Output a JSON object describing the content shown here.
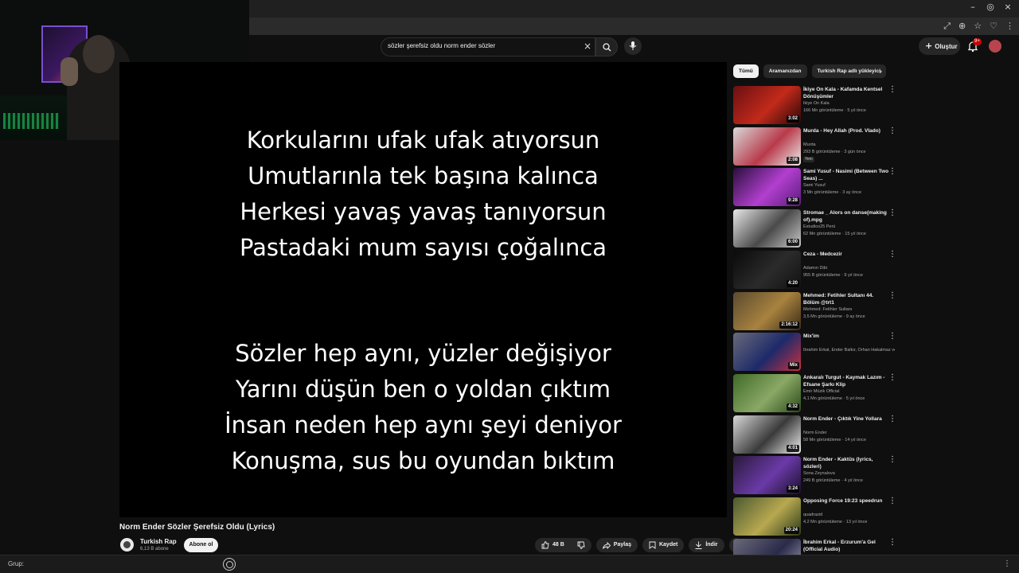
{
  "window_controls": {
    "minimize": "–",
    "restore": "◎",
    "close": "×"
  },
  "toolbar_icons": [
    "⤢",
    "⊕",
    "☆",
    "♡",
    "⋮"
  ],
  "search": {
    "query": "sözler şerefsiz oldu norm ender sözler",
    "clear": "×"
  },
  "header": {
    "create_label": "Oluştur",
    "create_plus": "+",
    "notif_count": "9+"
  },
  "video": {
    "lyrics_top": [
      "Korkularını ufak ufak atıyorsun",
      "Umutlarınla tek başına kalınca",
      "Herkesi yavaş yavaş tanıyorsun",
      "Pastadaki mum sayısı çoğalınca"
    ],
    "lyrics_bottom": [
      "Sözler hep aynı, yüzler değişiyor",
      "Yarını düşün ben o yoldan çıktım",
      "İnsan neden hep aynı şeyi deniyor",
      "Konuşma, sus bu oyundan bıktım"
    ]
  },
  "title": "Norm Ender Sözler Şerefsiz Oldu (Lyrics)",
  "channel": {
    "name": "Turkish Rap",
    "subs": "6,13 B abone",
    "subscribe": "Abone ol"
  },
  "actions": {
    "likes": "48 B",
    "share": "Paylaş",
    "save": "Kaydet",
    "download": "İndir",
    "more": "⋯"
  },
  "groupbar": {
    "label": "Grup:",
    "right": "⋮"
  },
  "chips": [
    "Tümü",
    "Aramanızdan",
    "Turkish Rap adlı yükleyici"
  ],
  "chip_next": "›",
  "recs": [
    {
      "title": "İkiye On Kala - Kafamda Kentsel Dönüşümler",
      "channel": "İkiye On Kala",
      "meta": "166 Mn görüntüleme · 5 yıl önce",
      "dur": "3:02",
      "new": "",
      "thumb": [
        "#6b0f12",
        "#c22a1a",
        "#2b0608"
      ]
    },
    {
      "title": "Murda - Hey Allah (Prod. Vlado)",
      "channel": "Murda",
      "meta": "293 B görüntüleme · 3 gün önce",
      "dur": "2:08",
      "new": "Yeni",
      "thumb": [
        "#d9d9d9",
        "#b83a4a",
        "#eeeeee"
      ]
    },
    {
      "title": "Sami Yusuf - Nasimi (Between Two Seas) ...",
      "channel": "Sami Yusuf",
      "meta": "3 Mn görüntüleme · 3 ay önce",
      "dur": "9:28",
      "new": "",
      "thumb": [
        "#2a0f3d",
        "#b23fcf",
        "#5a1c7a"
      ]
    },
    {
      "title": "Stromae _ Alors on danse(making of).mpg",
      "channel": "Estudios25 Perú",
      "meta": "62 Mn görüntüleme · 15 yıl önce",
      "dur": "6:00",
      "new": "",
      "thumb": [
        "#e8e8e8",
        "#4a4a4a",
        "#c9c9c9"
      ]
    },
    {
      "title": "Ceza - Medcezir",
      "channel": "Adamın Dibi",
      "meta": "955 B görüntüleme · 9 yıl önce",
      "dur": "4:20",
      "new": "",
      "thumb": [
        "#0a0a0a",
        "#2b2b2b",
        "#111111"
      ]
    },
    {
      "title": "Mehmed: Fetihler Sultanı 44. Bölüm @trt1",
      "channel": "Mehmed: Fetihler Sultanı",
      "meta": "3,5 Mn görüntüleme · 9 ay önce",
      "dur": "2:16:12",
      "new": "",
      "thumb": [
        "#5a4a30",
        "#a8823e",
        "#3a2a18"
      ]
    },
    {
      "title": "Mix'im",
      "channel": "İbrahim Erkal, Ender Balkır, Orhan Hakalmaz ve daha fazlası",
      "meta": "",
      "dur": "Mix",
      "new": "",
      "thumb": [
        "#6a6a7a",
        "#1d2a6a",
        "#c93040"
      ]
    },
    {
      "title": "Ankaralı Turgut - Kaymak Lazım - Efsane Şarkı Klip",
      "channel": "Emir Müzik Official",
      "meta": "4,1 Mn görüntüleme · 5 yıl önce",
      "dur": "4:32",
      "new": "",
      "thumb": [
        "#3f6a2a",
        "#8aa865",
        "#2a4a1a"
      ]
    },
    {
      "title": "Norm Ender - Çıktık Yine Yollara",
      "channel": "Norm Ender",
      "meta": "58 Mn görüntüleme · 14 yıl önce",
      "dur": "4:01",
      "new": "",
      "thumb": [
        "#d8d8d8",
        "#3a3a3a",
        "#f0f0f0"
      ]
    },
    {
      "title": "Norm Ender - Kaktüs (lyrics, sözleri)",
      "channel": "Sona Zeynalova",
      "meta": "249 B görüntüleme · 4 yıl önce",
      "dur": "3:24",
      "new": "",
      "thumb": [
        "#2a1a3a",
        "#6a3aa8",
        "#1a0f2a"
      ]
    },
    {
      "title": "Opposing Force 19:23 speedrun",
      "channel": "quadrazid",
      "meta": "4,2 Mn görüntüleme · 13 yıl önce",
      "dur": "20:24",
      "new": "",
      "thumb": [
        "#4a5a30",
        "#b8a850",
        "#2a3a18"
      ]
    },
    {
      "title": "İbrahim Erkal - Erzurum'a Gel (Official Audio)",
      "channel": "",
      "meta": "",
      "dur": "",
      "new": "",
      "thumb": [
        "#6a6a7a",
        "#2a2a4a",
        "#a8a8b8"
      ]
    }
  ],
  "colors": {
    "bg": "#0f0f0f",
    "panel": "#272727",
    "text": "#f1f1f1",
    "muted": "#aaaaaa",
    "accent": "#cc0000"
  }
}
